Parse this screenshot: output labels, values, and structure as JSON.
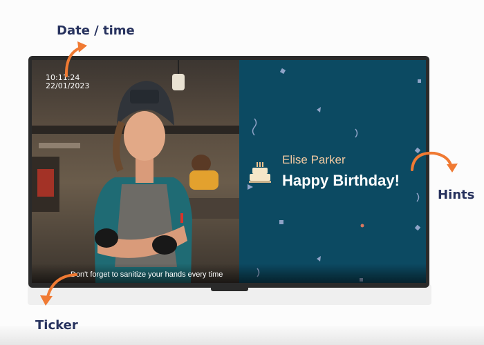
{
  "callouts": {
    "date_time": "Date / time",
    "hints": "Hints",
    "ticker": "Ticker"
  },
  "screen": {
    "clock": {
      "time": "10:11:24",
      "date": "22/01/2023"
    },
    "ticker_text": "Don't forget to sanitize your hands every time",
    "birthday": {
      "name": "Elise Parker",
      "message": "Happy Birthday!"
    }
  },
  "icons": {
    "arrow": "curved-arrow-icon",
    "cake": "birthday-cake-icon"
  },
  "colors": {
    "callout_text": "#27325e",
    "arrow": "#f07a33",
    "panel_bg": "#0c4a62",
    "name_text": "#f1c9a1"
  }
}
